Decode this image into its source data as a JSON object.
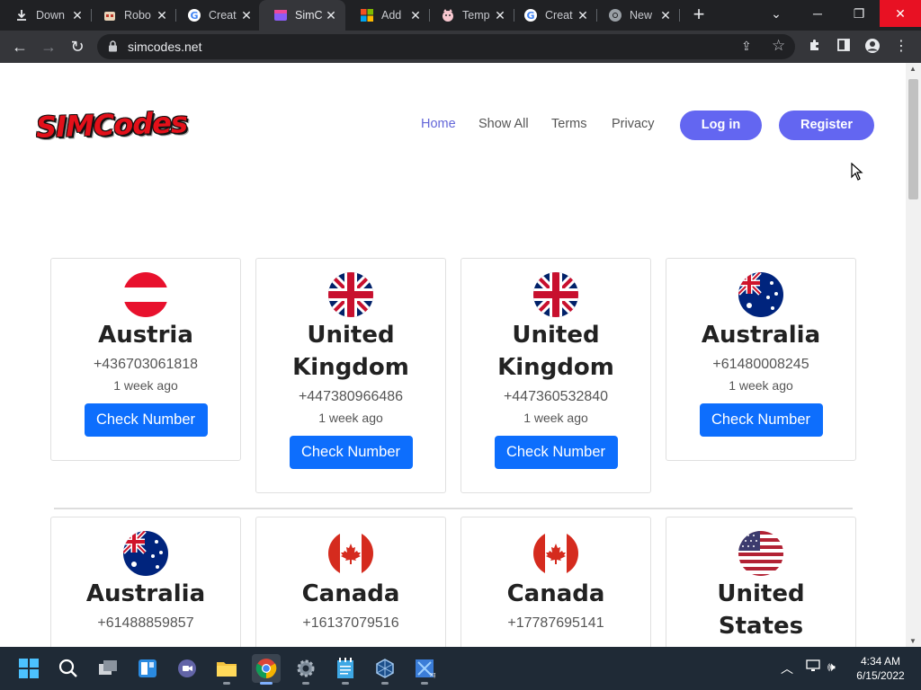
{
  "browser": {
    "tabs": [
      {
        "title": "Down",
        "icon": "download-icon"
      },
      {
        "title": "Robo",
        "icon": "robot-favicon"
      },
      {
        "title": "Creat",
        "icon": "google-favicon"
      },
      {
        "title": "SimC",
        "icon": "simcodes-favicon",
        "active": true
      },
      {
        "title": "Add",
        "icon": "microsoft-favicon"
      },
      {
        "title": "Temp",
        "icon": "temp-mail-favicon"
      },
      {
        "title": "Creat",
        "icon": "google-favicon"
      },
      {
        "title": "New",
        "icon": "chrome-favicon"
      }
    ],
    "url": "simcodes.net"
  },
  "site": {
    "logo_text": "SIMCodes",
    "nav": {
      "home": "Home",
      "show_all": "Show All",
      "terms": "Terms",
      "privacy": "Privacy",
      "login": "Log in",
      "register": "Register"
    }
  },
  "cards": [
    {
      "country": "Austria",
      "number": "+436703061818",
      "ago": "1 week ago",
      "button": "Check Number",
      "flag": "austria"
    },
    {
      "country": "United Kingdom",
      "number": "+447380966486",
      "ago": "1 week ago",
      "button": "Check Number",
      "flag": "uk"
    },
    {
      "country": "United Kingdom",
      "number": "+447360532840",
      "ago": "1 week ago",
      "button": "Check Number",
      "flag": "uk"
    },
    {
      "country": "Australia",
      "number": "+61480008245",
      "ago": "1 week ago",
      "button": "Check Number",
      "flag": "australia"
    },
    {
      "country": "Australia",
      "number": "+61488859857",
      "ago": "",
      "button": "",
      "flag": "australia"
    },
    {
      "country": "Canada",
      "number": "+16137079516",
      "ago": "",
      "button": "",
      "flag": "canada"
    },
    {
      "country": "Canada",
      "number": "+17787695141",
      "ago": "",
      "button": "",
      "flag": "canada"
    },
    {
      "country": "United States",
      "number": "",
      "ago": "",
      "button": "",
      "flag": "usa"
    }
  ],
  "taskbar": {
    "time": "4:34 AM",
    "date": "6/15/2022"
  },
  "colors": {
    "accent_purple": "#6366f1",
    "button_blue": "#0d6efd",
    "logo_red": "#e3101a"
  }
}
